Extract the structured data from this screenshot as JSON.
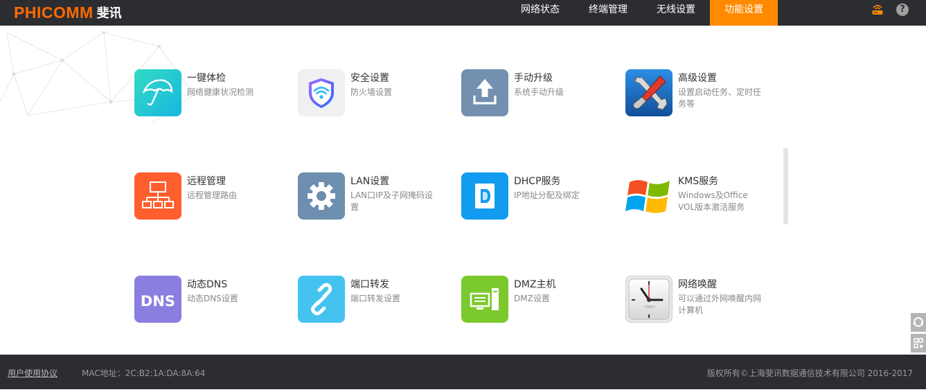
{
  "header": {
    "brand": "PHICOMM",
    "brand_cn": "斐讯",
    "tabs": [
      {
        "label": "网络状态",
        "active": false
      },
      {
        "label": "终端管理",
        "active": false
      },
      {
        "label": "无线设置",
        "active": false
      },
      {
        "label": "功能设置",
        "active": true
      }
    ],
    "icons": [
      "router-icon",
      "help-icon"
    ],
    "help_glyph": "?"
  },
  "tiles": [
    {
      "title": "一键体检",
      "desc": "网络健康状况检测",
      "icon": "umbrella-icon",
      "color": "#1fcfbf"
    },
    {
      "title": "安全设置",
      "desc": "防火墙设置",
      "icon": "shield-wifi-icon",
      "color": "#f0f0f0"
    },
    {
      "title": "手动升级",
      "desc": "系统手动升级",
      "icon": "upload-icon",
      "color": "#7390b0"
    },
    {
      "title": "高级设置",
      "desc": "设置启动任务、定时任务等",
      "icon": "tools-icon",
      "color": "#1a72c8"
    },
    {
      "title": "远程管理",
      "desc": "远程管理路由",
      "icon": "network-tree-icon",
      "color": "#ff5f2e"
    },
    {
      "title": "LAN设置",
      "desc": "LAN口IP及子网掩码设置",
      "icon": "gear-icon",
      "color": "#6d8eae"
    },
    {
      "title": "DHCP服务",
      "desc": "IP地址分配及绑定",
      "icon": "dhcp-icon",
      "color": "#129cf0"
    },
    {
      "title": "KMS服务",
      "desc": "Windows及Office VOL版本激活服务",
      "icon": "windows-icon",
      "color": "#ffffff"
    },
    {
      "title": "动态DNS",
      "desc": "动态DNS设置",
      "icon": "dns-icon",
      "color": "#8a7fe0",
      "label": "DNS"
    },
    {
      "title": "端口转发",
      "desc": "端口转发设置",
      "icon": "link-icon",
      "color": "#45c3f0"
    },
    {
      "title": "DMZ主机",
      "desc": "DMZ设置",
      "icon": "computer-icon",
      "color": "#7cc92e"
    },
    {
      "title": "网络唤醒",
      "desc": "可以通过外网唤醒内网计算机",
      "icon": "clock-icon",
      "color": "#e8e8e8",
      "label": "TIMEX"
    }
  ],
  "footer": {
    "agreement": "用户使用协议",
    "mac": "MAC地址：2C:B2:1A:DA:8A:64",
    "copyright": "版权所有©上海斐讯数据通信技术有限公司 2016-2017"
  }
}
